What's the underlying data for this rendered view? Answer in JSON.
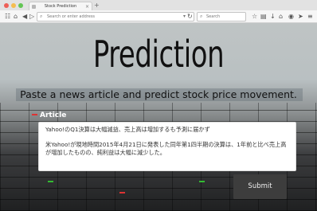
{
  "browser": {
    "tab_title": "Stock Prediction",
    "new_tab_label": "+",
    "tab_close_label": "×",
    "url_placeholder": "Search or enter address",
    "search_placeholder": "Search",
    "back_icon": "back-arrow-icon",
    "forward_icon": "forward-arrow-icon",
    "icons": [
      "bookmark-star-icon",
      "downloads-icon",
      "home-icon",
      "sync-icon",
      "menu-icon"
    ]
  },
  "page": {
    "title": "Prediction",
    "subtitle": "Paste a news article and predict stock price movement.",
    "article_label": "Article",
    "article_paragraphs": [
      "Yahoo!のQ1決算は大幅減益、売上高は増加するも予測に届かず",
      "米Yahoo!が現地時間2015年4月21日に発表した同年第1四半期の決算は、1年前と比べ売上高が増加したものの、純利益は大幅に減少した。"
    ],
    "submit_label": "Submit"
  }
}
